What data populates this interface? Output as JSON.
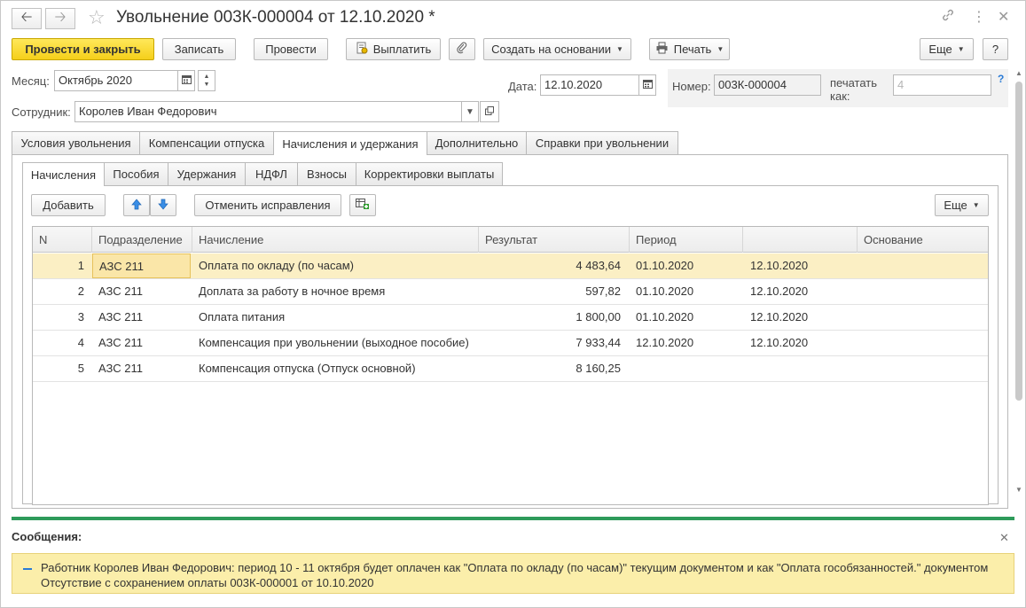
{
  "window": {
    "title": "Увольнение 003К-000004 от 12.10.2020 *",
    "back_icon": "arrow-left",
    "forward_icon": "arrow-right",
    "favorite_icon": "star-outline",
    "link_icon": "link",
    "more_icon": "vertical-dots",
    "close_icon": "close"
  },
  "toolbar": {
    "post_close": "Провести и закрыть",
    "save": "Записать",
    "post": "Провести",
    "pay": "Выплатить",
    "create_based": "Создать на основании",
    "print": "Печать",
    "more": "Еще",
    "help": "?"
  },
  "form": {
    "month_label": "Месяц:",
    "month_value": "Октябрь 2020",
    "date_label": "Дата:",
    "date_value": "12.10.2020",
    "number_label": "Номер:",
    "number_value": "003К-000004",
    "print_as_label_1": "печатать",
    "print_as_label_2": "как:",
    "print_as_value": "4",
    "print_as_help": "?",
    "employee_label": "Сотрудник:",
    "employee_value": "Королев Иван Федорович"
  },
  "tabs": [
    {
      "label": "Условия увольнения"
    },
    {
      "label": "Компенсации отпуска"
    },
    {
      "label": "Начисления и удержания",
      "active": true
    },
    {
      "label": "Дополнительно"
    },
    {
      "label": "Справки при увольнении"
    }
  ],
  "subtabs": [
    {
      "label": "Начисления",
      "active": true
    },
    {
      "label": "Пособия"
    },
    {
      "label": "Удержания"
    },
    {
      "label": "НДФЛ"
    },
    {
      "label": "Взносы"
    },
    {
      "label": "Корректировки выплаты"
    }
  ],
  "grid_toolbar": {
    "add": "Добавить",
    "cancel_corrections": "Отменить исправления",
    "more": "Еще"
  },
  "grid": {
    "columns": [
      "N",
      "Подразделение",
      "Начисление",
      "Результат",
      "Период",
      "",
      "Основание"
    ],
    "rows": [
      {
        "n": "1",
        "dept": "АЗС 211",
        "accrual": "Оплата по окладу (по часам)",
        "result": "4 483,64",
        "from": "01.10.2020",
        "to": "12.10.2020",
        "basis": ""
      },
      {
        "n": "2",
        "dept": "АЗС 211",
        "accrual": "Доплата за работу в ночное время",
        "result": "597,82",
        "from": "01.10.2020",
        "to": "12.10.2020",
        "basis": ""
      },
      {
        "n": "3",
        "dept": "АЗС 211",
        "accrual": "Оплата питания",
        "result": "1 800,00",
        "from": "01.10.2020",
        "to": "12.10.2020",
        "basis": ""
      },
      {
        "n": "4",
        "dept": "АЗС 211",
        "accrual": "Компенсация при увольнении (выходное пособие)",
        "result": "7 933,44",
        "from": "12.10.2020",
        "to": "12.10.2020",
        "basis": ""
      },
      {
        "n": "5",
        "dept": "АЗС 211",
        "accrual": "Компенсация отпуска (Отпуск основной)",
        "result": "8 160,25",
        "from": "",
        "to": "",
        "basis": ""
      }
    ]
  },
  "messages": {
    "title": "Сообщения:",
    "line1": "Работник Королев Иван Федорович: период 10 - 11 октября будет оплачен как \"Оплата по окладу (по часам)\" текущим документом и как \"Оплата гособязанностей.\" документом",
    "line2": "Отсутствие с сохранением оплаты 003К-000001 от 10.10.2020"
  },
  "colors": {
    "primary_button": "#f5cf1a",
    "selected_row": "#fbefc4",
    "message_bar": "#2e9b5a",
    "message_bg": "#fbeeaa"
  }
}
